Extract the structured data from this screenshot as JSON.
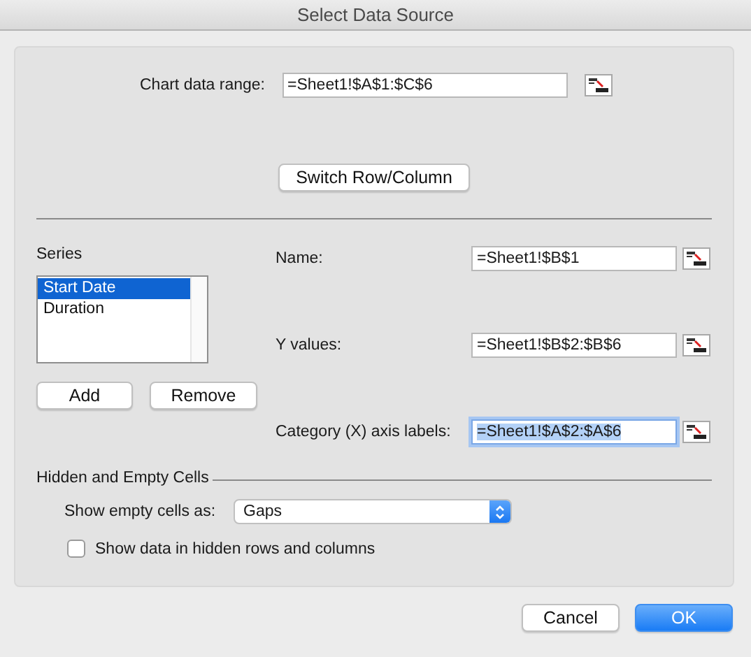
{
  "window": {
    "title": "Select Data Source"
  },
  "chart_data_range": {
    "label": "Chart data range:",
    "value": "=Sheet1!$A$1:$C$6"
  },
  "switch_button": "Switch Row/Column",
  "series": {
    "label": "Series",
    "items": [
      {
        "name": "Start Date",
        "selected": true
      },
      {
        "name": "Duration",
        "selected": false
      }
    ],
    "buttons": [
      "Add",
      "Remove"
    ]
  },
  "fields": [
    {
      "label": "Name:",
      "value": "=Sheet1!$B$1",
      "focused": false
    },
    {
      "label": "Y values:",
      "value": "=Sheet1!$B$2:$B$6",
      "focused": false
    },
    {
      "label": "Category (X) axis labels:",
      "value": "=Sheet1!$A$2:$A$6",
      "focused": true
    }
  ],
  "hidden_empty": {
    "title": "Hidden and Empty Cells",
    "show_empty_label": "Show empty cells as:",
    "show_empty_value": "Gaps",
    "hidden_rows_label": "Show data in hidden rows and columns",
    "hidden_rows_checked": false
  },
  "buttons": [
    {
      "label": "Cancel",
      "default": false
    },
    {
      "label": "OK",
      "default": true
    }
  ]
}
